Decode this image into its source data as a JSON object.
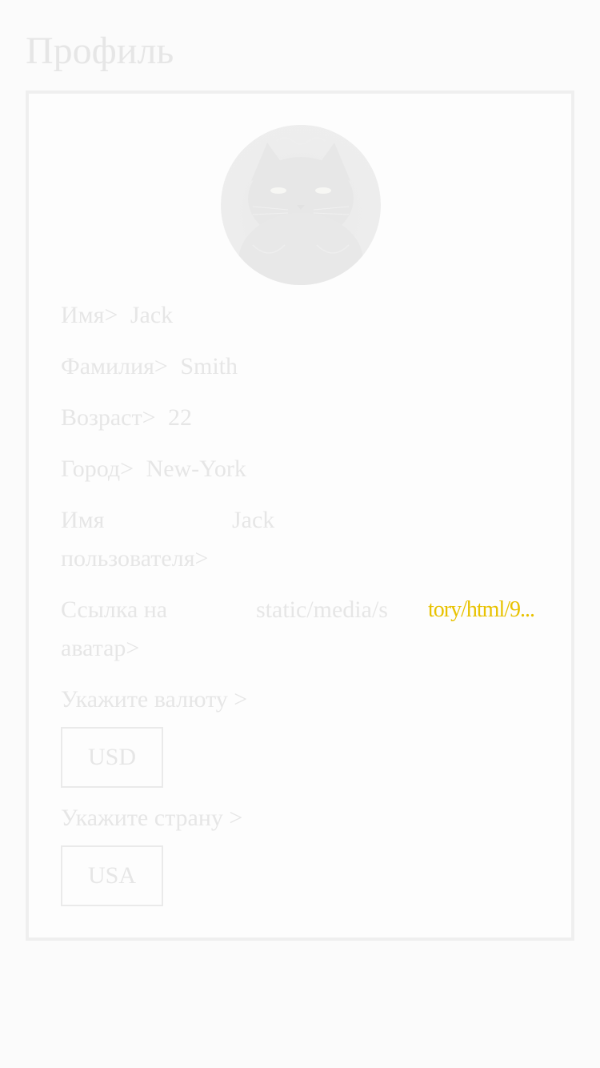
{
  "page": {
    "title": "Профиль"
  },
  "profile": {
    "avatar_icon": "cat-avatar-image",
    "name_label": "Имя>",
    "name_value": "Jack",
    "surname_label": "Фамилия>",
    "surname_value": "Smith",
    "age_label": "Возраст>",
    "age_value": "22",
    "city_label": "Город>",
    "city_value": "New-York",
    "username_label": "Имя пользователя>",
    "username_value": "Jack",
    "avatar_link_label": "Ссылка на аватар>",
    "avatar_link_value": "static/media/s",
    "avatar_link_tail": "tory/html/9..."
  },
  "currency": {
    "prompt": "Укажите валюту >",
    "selected": "USD"
  },
  "country": {
    "prompt": "Укажите страну >",
    "selected": "USA"
  },
  "colors": {
    "background": "#fbfbfb",
    "text": "#e6e6e6",
    "card_border": "#efefef",
    "overlay_yellow": "#e8c200",
    "overlay_red": "#d62a12"
  }
}
